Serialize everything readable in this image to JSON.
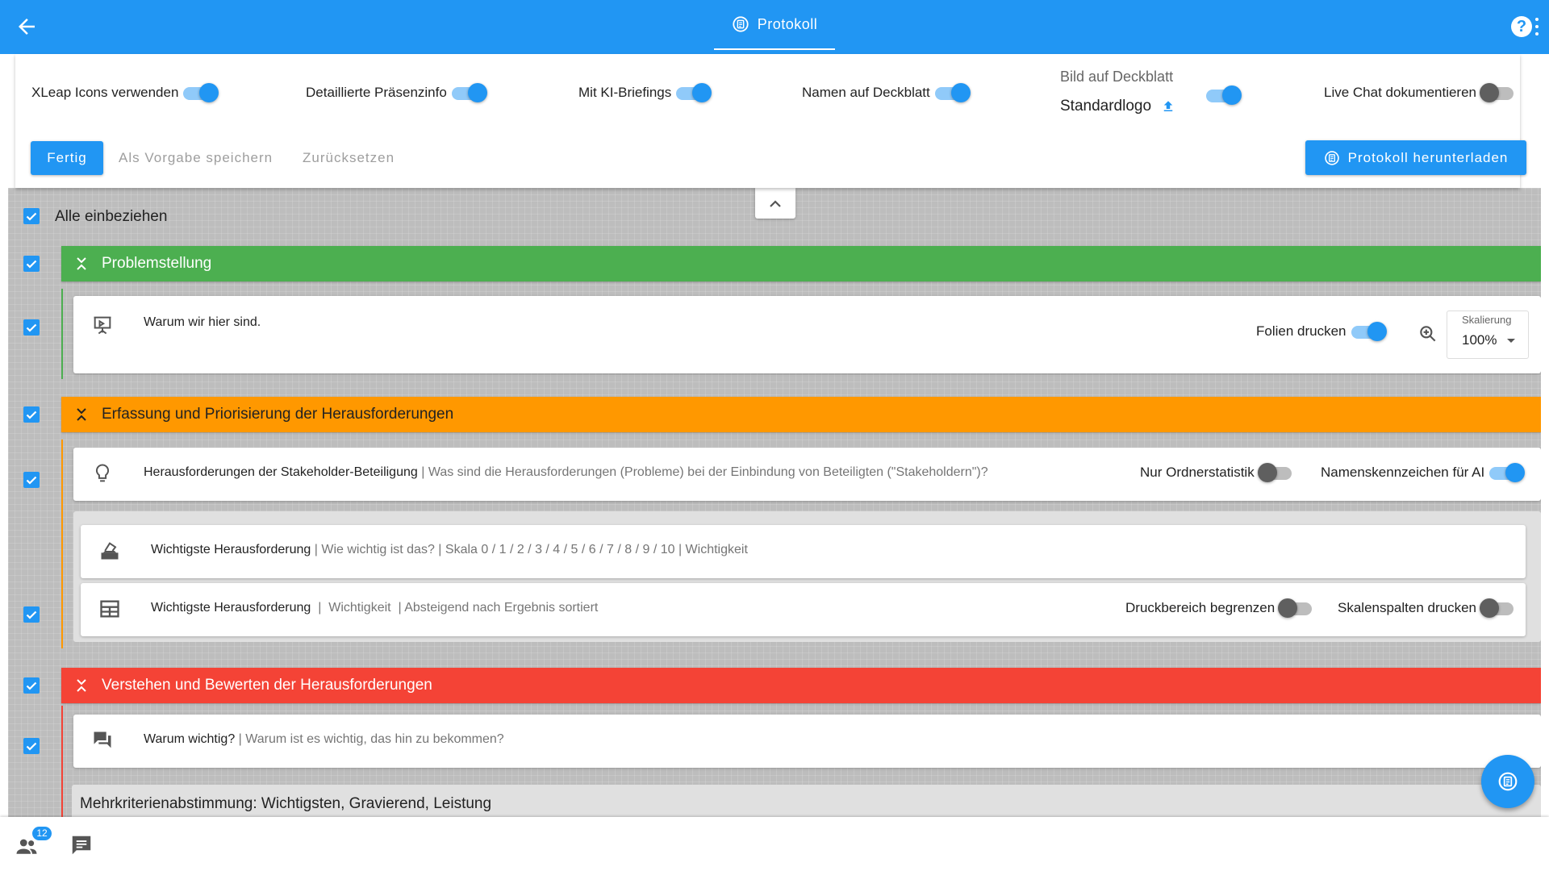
{
  "header": {
    "tab_label": "Protokoll",
    "help_label": "?"
  },
  "settings": {
    "xleap_icons": {
      "label": "XLeap Icons verwenden",
      "on": true
    },
    "presence": {
      "label": "Detaillierte Präsenzinfo",
      "on": true
    },
    "ki_briefings": {
      "label": "Mit KI-Briefings",
      "on": true
    },
    "names_cover": {
      "label": "Namen auf Deckblatt",
      "on": true
    },
    "cover_image": {
      "label": "Bild auf Deckblatt",
      "value": "Standardlogo",
      "on": true
    },
    "live_chat": {
      "label": "Live Chat dokumentieren",
      "on": false
    },
    "done_button": "Fertig",
    "save_template_button": "Als Vorgabe speichern",
    "reset_button": "Zurücksetzen",
    "download_button": "Protokoll herunterladen"
  },
  "content": {
    "include_all_label": "Alle einbeziehen",
    "phases": [
      {
        "title": "Problemstellung",
        "color": "#4caf50"
      },
      {
        "title": "Erfassung und Priorisierung der Herausforderungen",
        "color": "#ff9800"
      },
      {
        "title": "Verstehen und Bewerten der Herausforderungen",
        "color": "#f44336"
      }
    ],
    "activities": {
      "presentation": {
        "title": "Warum wir hier sind.",
        "print_slides_label": "Folien drucken",
        "scale_label": "Skalierung",
        "scale_value": "100%"
      },
      "brainstorm": {
        "title": "Herausforderungen der Stakeholder-Beteiligung",
        "subtitle": " | Was sind die Herausforderungen (Probleme) bei der Einbindung von Beteiligten (\"Stakeholdern\")?",
        "folder_stats_label": "Nur Ordnerstatistik",
        "name_tags_label": "Namenskennzeichen für AI"
      },
      "vote": {
        "title": "Wichtigste Herausforderung",
        "subtitle": " | Wie wichtig ist das? | Skala 0 / 1 / 2 / 3 / 4 / 5 / 6 / 7 / 8 / 9 / 10 | Wichtigkeit"
      },
      "results": {
        "title": "Wichtigste Herausforderung",
        "subtitle": "  |  Wichtigkeit  | Absteigend nach Ergebnis sortiert",
        "limit_print_label": "Druckbereich begrenzen",
        "scale_columns_label": "Skalenspalten drucken"
      },
      "discussion": {
        "title": "Warum wichtig?",
        "subtitle": " | Warum ist es wichtig, das hin zu bekommen?"
      },
      "multicriteria": {
        "title": "Mehrkriterienabstimmung: Wichtigsten, Gravierend, Leistung"
      }
    }
  },
  "footer": {
    "participants_count": "12"
  },
  "colors": {
    "primary": "#2196f3",
    "green": "#4caf50",
    "orange": "#ff9800",
    "red": "#f44336"
  },
  "icons": [
    "arrow-back-icon",
    "protocol-icon",
    "help-icon",
    "more-vert-icon",
    "upload-icon",
    "chevron-up-icon",
    "check-icon",
    "unfold-icon",
    "presentation-icon",
    "zoom-in-icon",
    "dropdown-arrow-icon",
    "lightbulb-icon",
    "ballot-icon",
    "table-icon",
    "forum-icon",
    "people-icon",
    "chat-icon"
  ]
}
